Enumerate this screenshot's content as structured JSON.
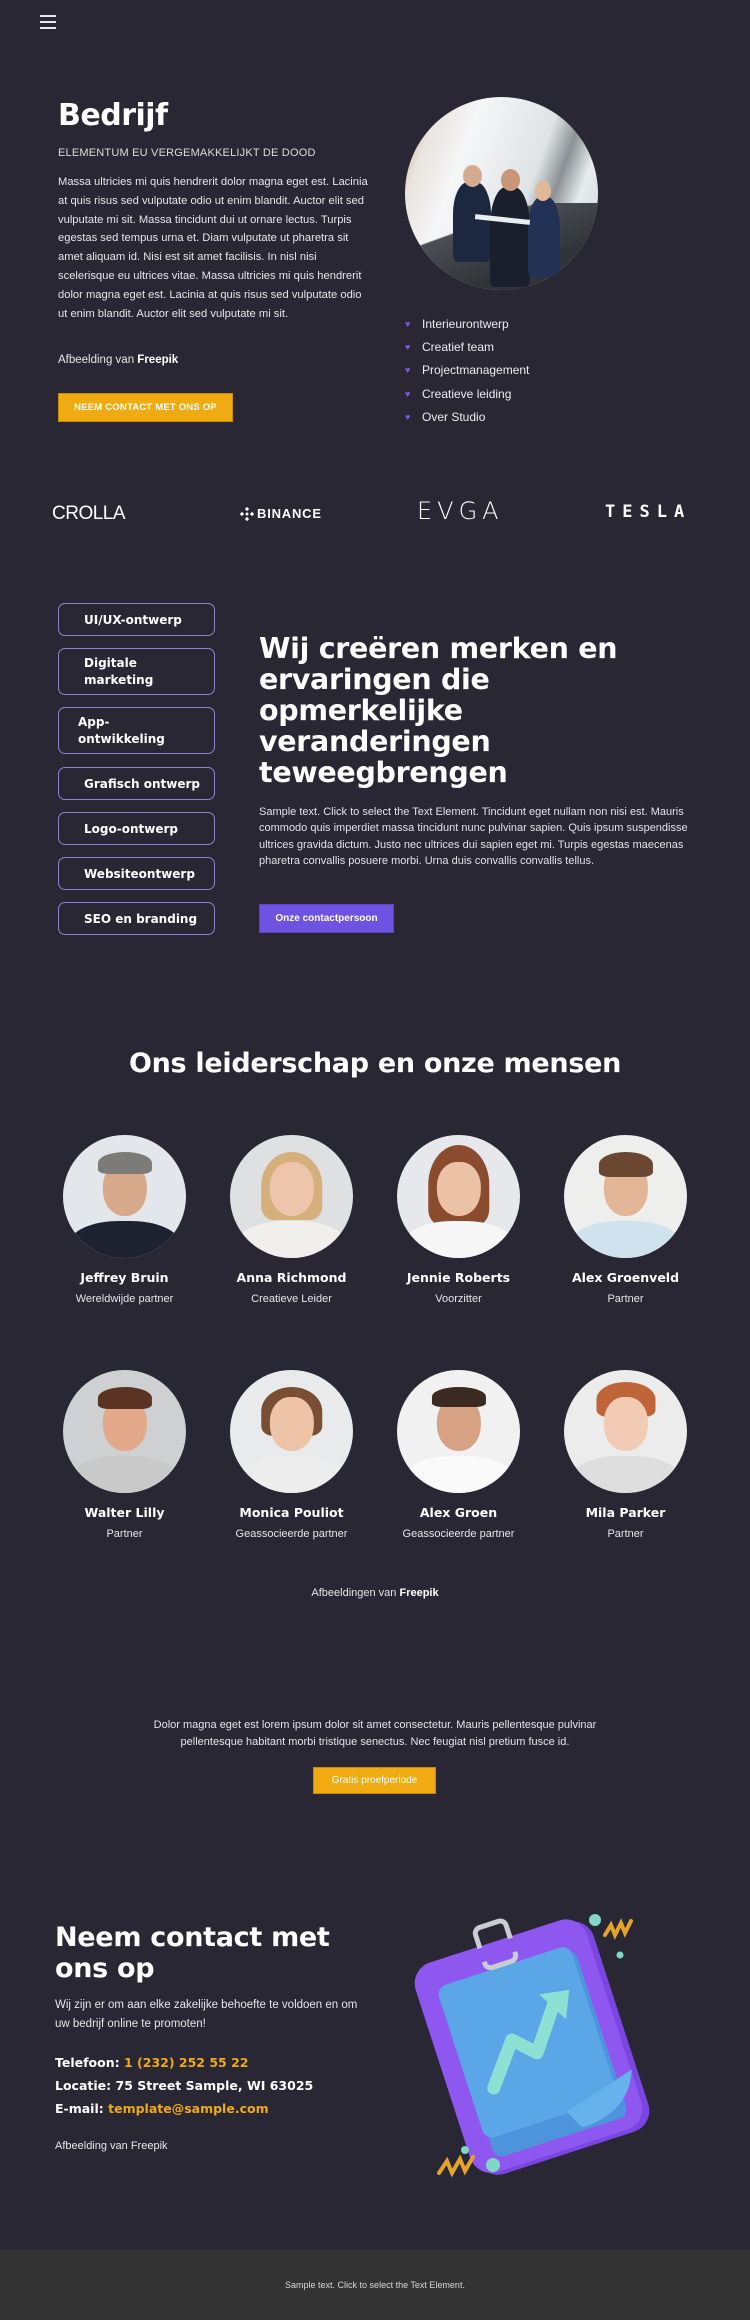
{
  "header": {
    "menu_icon": "hamburger-icon"
  },
  "hero": {
    "title": "Bedrijf",
    "subtitle": "ELEMENTUM EU VERGEMAKKELIJKT DE DOOD",
    "body": "Massa ultricies mi quis hendrerit dolor magna eget est. Lacinia at quis risus sed vulputate odio ut enim blandit. Auctor elit sed vulputate mi sit. Massa tincidunt dui ut ornare lectus. Turpis egestas sed tempus urna et. Diam vulputate ut pharetra sit amet aliquam id. Nisi est sit amet facilisis. In nisl nisi scelerisque eu ultrices vitae. Massa ultricies mi quis hendrerit dolor magna eget est. Lacinia at quis risus sed vulputate odio ut enim blandit. Auctor elit sed vulputate mi sit.",
    "credit_prefix": "Afbeelding van ",
    "credit_name": "Freepik",
    "button_label": "NEEM CONTACT MET ONS OP",
    "features": [
      "Interieurontwerp",
      "Creatief team",
      "Projectmanagement",
      "Creatieve leiding",
      "Over Studio"
    ],
    "feature_icon": "heart-icon"
  },
  "logos": [
    "CROLLA",
    "BINANCE",
    "EVGA",
    "TESLA"
  ],
  "services": {
    "items": [
      "UI/UX-ontwerp",
      "Digitale marketing",
      "App-ontwikkeling",
      "Grafisch ontwerp",
      "Logo-ontwerp",
      "Websiteontwerp",
      "SEO en branding"
    ],
    "heading": "Wij creëren merken en ervaringen die opmerkelijke veranderingen teweegbrengen",
    "body": "Sample text. Click to select the Text Element. Tincidunt eget nullam non nisi est. Mauris commodo quis imperdiet massa tincidunt nunc pulvinar sapien. Quis ipsum suspendisse ultrices gravida dictum. Justo nec ultrices dui sapien eget mi. Turpis egestas maecenas pharetra convallis posuere morbi. Urna duis convallis convallis tellus.",
    "button_label": "Onze contactpersoon"
  },
  "team": {
    "title": "Ons leiderschap en onze mensen",
    "members": [
      {
        "name": "Jeffrey Bruin",
        "role": "Wereldwijde partner"
      },
      {
        "name": "Anna Richmond",
        "role": "Creatieve Leider"
      },
      {
        "name": "Jennie Roberts",
        "role": "Voorzitter"
      },
      {
        "name": "Alex Groenveld",
        "role": "Partner"
      },
      {
        "name": "Walter Lilly",
        "role": "Partner"
      },
      {
        "name": "Monica Pouliot",
        "role": "Geassocieerde partner"
      },
      {
        "name": "Alex Groen",
        "role": "Geassocieerde partner"
      },
      {
        "name": "Mila Parker",
        "role": "Partner"
      }
    ],
    "credit_prefix": "Afbeeldingen van ",
    "credit_name": "Freepik"
  },
  "cta": {
    "body": "Dolor magna eget est lorem ipsum dolor sit amet consectetur. Mauris pellentesque pulvinar pellentesque habitant morbi tristique senectus. Nec feugiat nisl pretium fusce id.",
    "button_label": "Gratis proefperiode"
  },
  "contact": {
    "title": "Neem contact met ons op",
    "body": "Wij zijn er om aan elke zakelijke behoefte te voldoen en om uw bedrijf online te promoten!",
    "phone_label": "Telefoon: ",
    "phone_value": "1 (232) 252 55 22",
    "location_label": "Locatie: ",
    "location_value": "75 Street Sample, WI 63025",
    "email_label": "E-mail: ",
    "email_value": "template@sample.com",
    "credit": "Afbeelding van Freepik"
  },
  "footer": {
    "text": "Sample text. Click to select the Text Element."
  },
  "colors": {
    "background": "#292733",
    "accent_yellow": "#f0ab13",
    "accent_purple": "#6c53e2",
    "footer_bg": "#333333"
  }
}
